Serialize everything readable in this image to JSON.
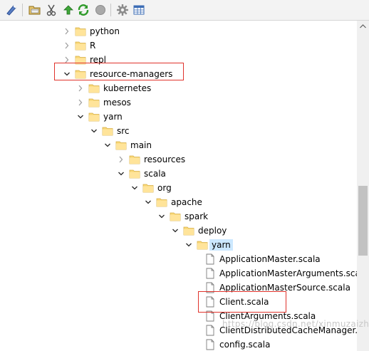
{
  "toolbar": {
    "buttons": [
      {
        "name": "sync-tool-button",
        "icon": "plugin-icon"
      },
      {
        "name": "open-project-button",
        "icon": "folder-open-icon"
      },
      {
        "name": "remove-button",
        "icon": "scissors-icon"
      },
      {
        "name": "up-button",
        "icon": "arrow-up-icon"
      },
      {
        "name": "refresh-button",
        "icon": "refresh-icon"
      },
      {
        "name": "stop-button",
        "icon": "stop-icon"
      },
      {
        "name": "settings-button",
        "icon": "gear-icon"
      },
      {
        "name": "table-view-button",
        "icon": "table-icon"
      }
    ]
  },
  "tree": {
    "nodes": [
      {
        "label": "python",
        "type": "folder",
        "state": "collapsed"
      },
      {
        "label": "R",
        "type": "folder",
        "state": "collapsed"
      },
      {
        "label": "repl",
        "type": "folder",
        "state": "collapsed"
      },
      {
        "label": "resource-managers",
        "type": "folder",
        "state": "expanded"
      },
      {
        "label": "kubernetes",
        "type": "folder",
        "state": "collapsed"
      },
      {
        "label": "mesos",
        "type": "folder",
        "state": "collapsed"
      },
      {
        "label": "yarn",
        "type": "folder",
        "state": "expanded"
      },
      {
        "label": "src",
        "type": "folder",
        "state": "expanded"
      },
      {
        "label": "main",
        "type": "folder",
        "state": "expanded"
      },
      {
        "label": "resources",
        "type": "folder",
        "state": "collapsed"
      },
      {
        "label": "scala",
        "type": "folder",
        "state": "expanded"
      },
      {
        "label": "org",
        "type": "folder",
        "state": "expanded"
      },
      {
        "label": "apache",
        "type": "folder",
        "state": "expanded"
      },
      {
        "label": "spark",
        "type": "folder",
        "state": "expanded"
      },
      {
        "label": "deploy",
        "type": "folder",
        "state": "expanded"
      },
      {
        "label": "yarn",
        "type": "folder",
        "state": "expanded",
        "selected": true
      },
      {
        "label": "ApplicationMaster.scala",
        "type": "file"
      },
      {
        "label": "ApplicationMasterArguments.scala",
        "type": "file"
      },
      {
        "label": "ApplicationMasterSource.scala",
        "type": "file"
      },
      {
        "label": "Client.scala",
        "type": "file"
      },
      {
        "label": "ClientArguments.scala",
        "type": "file"
      },
      {
        "label": "ClientDistributedCacheManager.scala",
        "type": "file"
      },
      {
        "label": "config.scala",
        "type": "file"
      }
    ]
  },
  "colors": {
    "highlight_box": "#e0332c",
    "folder": "#f8d775",
    "selection": "#cce8ff"
  },
  "watermark": "https://blog.csdn.net/xinmuzaizhen"
}
